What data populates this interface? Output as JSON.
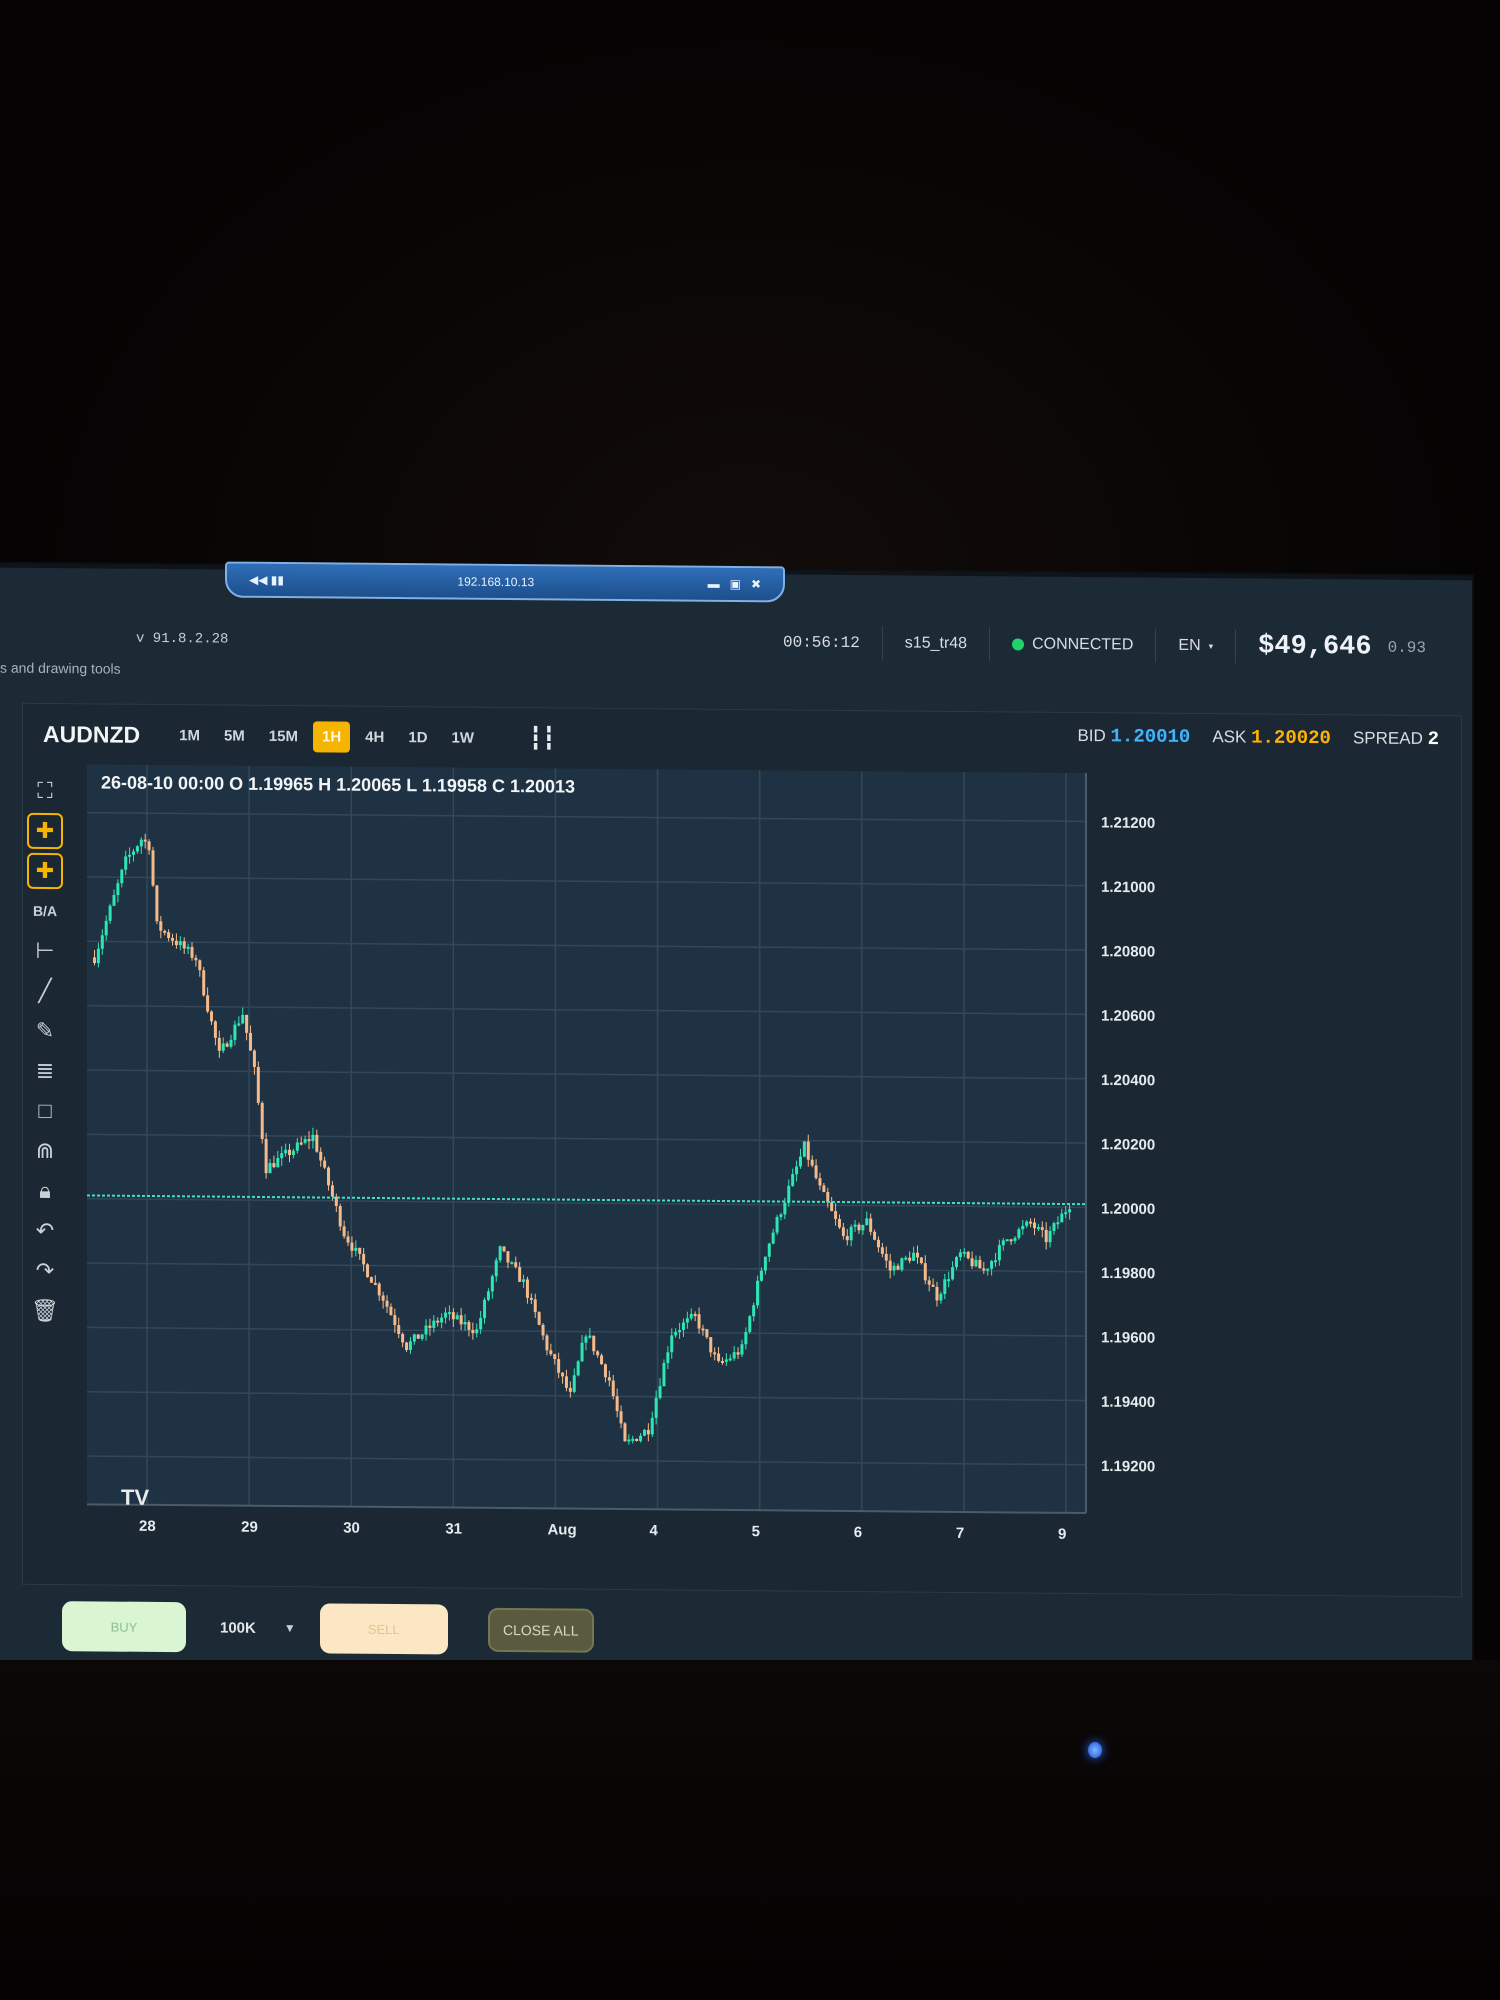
{
  "remote": {
    "address": "192.168.10.13"
  },
  "app": {
    "version": "v 91.8.2.28",
    "hint_text": "s and drawing tools",
    "clock": "00:56:12",
    "user": "s15_tr48",
    "status": "CONNECTED",
    "language": "EN",
    "balance": "$49,646",
    "balance_small": "0.93"
  },
  "symbol": "AUDNZD",
  "timeframes": [
    "1M",
    "5M",
    "15M",
    "1H",
    "4H",
    "1D",
    "1W"
  ],
  "active_timeframe": "1H",
  "quote": {
    "bid_label": "BID",
    "bid": "1.20010",
    "ask_label": "ASK",
    "ask": "1.20020",
    "spread_label": "SPREAD",
    "spread": "2"
  },
  "ohlc_text": "26-08-10 00:00 O 1.19965 H 1.20065 L 1.19958 C 1.20013",
  "tv_mark": "TV",
  "tools": {
    "bidask": "B/A"
  },
  "trade": {
    "buy": "BUY",
    "sell": "SELL",
    "quantity": "100K",
    "close_all": "CLOSE ALL"
  },
  "colors": {
    "up": "#2ee6b4",
    "down": "#f5b98a",
    "price_line": "#3fe0c0",
    "accent": "#f5b400",
    "grid": "#34475a"
  },
  "chart_data": {
    "type": "candlestick",
    "ylim": [
      1.1905,
      1.2135
    ],
    "y_ticks": [
      "1.21200",
      "1.21000",
      "1.20800",
      "1.20600",
      "1.20400",
      "1.20200",
      "1.20000",
      "1.19800",
      "1.19600",
      "1.19400",
      "1.19200"
    ],
    "x_ticks": [
      "28",
      "29",
      "30",
      "31",
      "Aug",
      "4",
      "5",
      "6",
      "7",
      "9"
    ],
    "current_price": 1.2001,
    "anchors": [
      [
        0,
        1.2075
      ],
      [
        8,
        1.2105
      ],
      [
        12,
        1.2112
      ],
      [
        14,
        1.211
      ],
      [
        16,
        1.2085
      ],
      [
        26,
        1.2075
      ],
      [
        32,
        1.2045
      ],
      [
        38,
        1.2058
      ],
      [
        41,
        1.204
      ],
      [
        44,
        1.201
      ],
      [
        56,
        1.202
      ],
      [
        64,
        1.199
      ],
      [
        74,
        1.197
      ],
      [
        80,
        1.1955
      ],
      [
        90,
        1.1965
      ],
      [
        98,
        1.196
      ],
      [
        104,
        1.1985
      ],
      [
        110,
        1.1975
      ],
      [
        116,
        1.1955
      ],
      [
        122,
        1.194
      ],
      [
        126,
        1.196
      ],
      [
        132,
        1.1945
      ],
      [
        136,
        1.1925
      ],
      [
        142,
        1.193
      ],
      [
        148,
        1.196
      ],
      [
        154,
        1.1965
      ],
      [
        160,
        1.195
      ],
      [
        166,
        1.1955
      ],
      [
        172,
        1.1985
      ],
      [
        178,
        1.2005
      ],
      [
        182,
        1.2018
      ],
      [
        186,
        1.2005
      ],
      [
        192,
        1.199
      ],
      [
        198,
        1.1995
      ],
      [
        204,
        1.198
      ],
      [
        210,
        1.1985
      ],
      [
        216,
        1.1972
      ],
      [
        222,
        1.1985
      ],
      [
        228,
        1.198
      ],
      [
        234,
        1.199
      ],
      [
        240,
        1.1995
      ],
      [
        244,
        1.199
      ],
      [
        250,
        1.2001
      ]
    ]
  }
}
